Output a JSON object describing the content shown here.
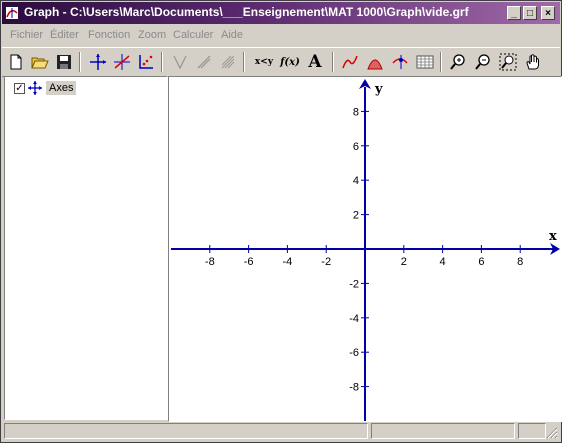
{
  "window": {
    "title": "Graph - C:\\Users\\Marc\\Documents\\___Enseignement\\MAT 1000\\Graph\\vide.grf"
  },
  "titlebar_buttons": {
    "minimize": "_",
    "maximize": "□",
    "close": "×"
  },
  "menu": [
    {
      "id": "fichier",
      "label": "Fichier"
    },
    {
      "id": "editer",
      "label": "Éditer"
    },
    {
      "id": "fonction",
      "label": "Fonction"
    },
    {
      "id": "zoom",
      "label": "Zoom"
    },
    {
      "id": "calculer",
      "label": "Calculer"
    },
    {
      "id": "aide",
      "label": "Aide"
    }
  ],
  "toolbar": [
    {
      "icon": "new-file-icon"
    },
    {
      "icon": "open-folder-icon"
    },
    {
      "icon": "save-disk-icon"
    },
    {
      "icon": "axes-icon"
    },
    {
      "icon": "insert-function-icon"
    },
    {
      "icon": "point-series-icon"
    },
    {
      "icon": "tangent-icon"
    },
    {
      "icon": "shade-icon"
    },
    {
      "icon": "hatch-icon"
    },
    {
      "icon": "relation-icon",
      "label": "x<y"
    },
    {
      "icon": "function-fx-icon",
      "label": "f(x)"
    },
    {
      "icon": "text-label-icon",
      "label": "A"
    },
    {
      "icon": "trendline-icon"
    },
    {
      "icon": "shading-icon"
    },
    {
      "icon": "eval-icon"
    },
    {
      "icon": "table-icon"
    },
    {
      "icon": "zoom-in-icon"
    },
    {
      "icon": "zoom-out-icon"
    },
    {
      "icon": "zoom-window-icon"
    },
    {
      "icon": "pan-hand-icon"
    }
  ],
  "tree": {
    "checked": true,
    "check_mark": "✓",
    "item_label": "Axes"
  },
  "axes": {
    "x_label": "x",
    "y_label": "y",
    "x_ticks": [
      "-8",
      "-6",
      "-4",
      "-2",
      "2",
      "4",
      "6",
      "8"
    ],
    "y_ticks": [
      "8",
      "6",
      "4",
      "2",
      "-2",
      "-4",
      "-6",
      "-8"
    ],
    "axis_color": "#0000a8"
  },
  "colors": {
    "title_gradient_start": "#2a0c3e",
    "title_gradient_end": "#a06aa8",
    "chrome": "#d4d0c8",
    "disabled_text": "#8a8a8a"
  }
}
